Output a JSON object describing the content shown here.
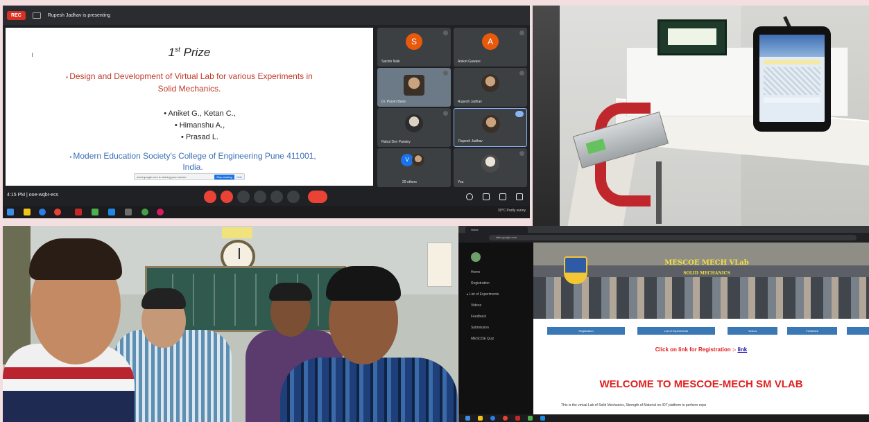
{
  "meeting": {
    "rec_label": "REC",
    "presenting_text": "Rupesh Jadhav is presenting",
    "slide": {
      "title_main": "1",
      "title_sup": "st",
      "title_rest": " Prize",
      "project_line1": "Design and Development of Virtual Lab for various Experiments in",
      "project_line2": "Solid Mechanics.",
      "names": [
        "• Aniket G., Ketan C.,",
        "• Himanshu A.,",
        "• Prasad L."
      ],
      "college_line1": "Modern Education Society's College of Engineering Pune 411001,",
      "college_line2": "India.",
      "share_text": "meet.google.com is sharing your screen.",
      "stop_label": "Stop sharing",
      "hide_label": "Hide"
    },
    "participants": [
      {
        "name": "Sachin Naik",
        "initial": "S",
        "color": "#e8590c"
      },
      {
        "name": "Aniket Gaware",
        "initial": "A",
        "color": "#e8590c"
      },
      {
        "name": "Dr. Pravin Bane",
        "initial": "",
        "color": ""
      },
      {
        "name": "Rupesh Jadhav",
        "initial": "",
        "color": ""
      },
      {
        "name": "Rahul Dev Pandey",
        "initial": "",
        "color": ""
      },
      {
        "name": "Rupesh Jadhav",
        "initial": "",
        "color": ""
      },
      {
        "name": "29 others",
        "initial": "V",
        "color": "#1a73e8"
      },
      {
        "name": "You",
        "initial": "",
        "color": ""
      }
    ],
    "time_text": "4:15 PM  |  ooe-wqbr-ecs",
    "tray_text": "30°C  Partly sunny"
  },
  "browser": {
    "tab_title": "Home",
    "url": "sites.google.com",
    "sidebar": [
      "Home",
      "Registration",
      "▸ List of Experiments",
      "Videos",
      "Feedback",
      "Submission",
      "MESCOE Quiz"
    ],
    "banner_title": "MESCOE MECH VLab",
    "banner_sub": "SOLID MECHANICS",
    "nav_buttons": [
      "Registration",
      "List of Experiments",
      "Videos",
      "Feedback",
      ""
    ],
    "reg_prefix": "Click on link for Registration :- ",
    "reg_link": "link",
    "welcome": "WELCOME TO MESCOE-MECH SM VLAB",
    "intro": "This is the virtual Lab of Solid Mechanics, Strength of Material on IOT platform to perform expe"
  }
}
